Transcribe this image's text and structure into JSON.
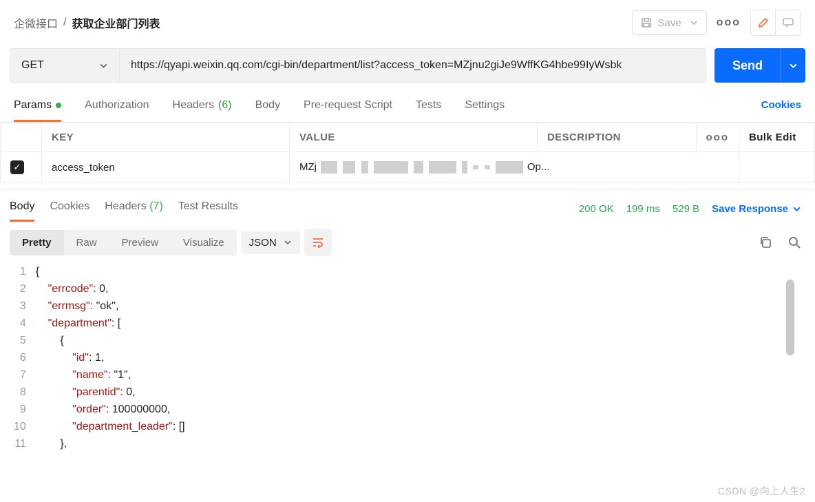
{
  "breadcrumb": {
    "folder": "企微接口",
    "sep": "/",
    "name": "获取企业部门列表"
  },
  "toolbar": {
    "save": "Save"
  },
  "request": {
    "method": "GET",
    "url": "https://qyapi.weixin.qq.com/cgi-bin/department/list?access_token=MZjnu2giJe9WffKG4hbe99IyWsbk",
    "send": "Send"
  },
  "tabs": {
    "params": "Params",
    "auth": "Authorization",
    "headers": "Headers",
    "headers_count": "(6)",
    "body": "Body",
    "prerequest": "Pre-request Script",
    "tests": "Tests",
    "settings": "Settings",
    "cookies": "Cookies"
  },
  "params_table": {
    "head_key": "KEY",
    "head_value": "VALUE",
    "head_desc": "DESCRIPTION",
    "bulk": "Bulk Edit",
    "rows": [
      {
        "key": "access_token",
        "value_prefix": "MZj",
        "value_suffix": "Op..."
      }
    ]
  },
  "response": {
    "tabs": {
      "body": "Body",
      "cookies": "Cookies",
      "headers": "Headers",
      "headers_count": "(7)",
      "tests": "Test Results"
    },
    "status": "200 OK",
    "time": "199 ms",
    "size": "529 B",
    "save": "Save Response"
  },
  "view": {
    "pretty": "Pretty",
    "raw": "Raw",
    "preview": "Preview",
    "visualize": "Visualize",
    "format": "JSON"
  },
  "code_lines": [
    "{",
    "    \"errcode\": 0,",
    "    \"errmsg\": \"ok\",",
    "    \"department\": [",
    "        {",
    "            \"id\": 1,",
    "            \"name\": \"1\",",
    "            \"parentid\": 0,",
    "            \"order\": 100000000,",
    "            \"department_leader\": []",
    "        },"
  ],
  "watermark": "CSDN @向上人生2"
}
